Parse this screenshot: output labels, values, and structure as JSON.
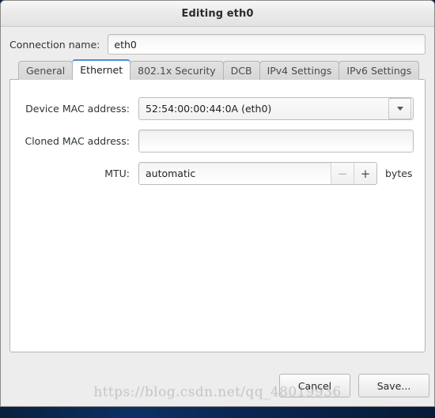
{
  "window": {
    "title": "Editing eth0"
  },
  "connection": {
    "label": "Connection name:",
    "value": "eth0",
    "placeholder": ""
  },
  "tabs": [
    {
      "label": "General",
      "active": false
    },
    {
      "label": "Ethernet",
      "active": true
    },
    {
      "label": "802.1x Security",
      "active": false
    },
    {
      "label": "DCB",
      "active": false
    },
    {
      "label": "IPv4 Settings",
      "active": false
    },
    {
      "label": "IPv6 Settings",
      "active": false
    }
  ],
  "ethernet_form": {
    "device_mac": {
      "label": "Device MAC address:",
      "value": "52:54:00:00:44:0A (eth0)",
      "icon": "chevron-down-icon"
    },
    "cloned_mac": {
      "label": "Cloned MAC address:",
      "value": "",
      "placeholder": ""
    },
    "mtu": {
      "label": "MTU:",
      "value": "automatic",
      "decrement": "−",
      "increment": "+",
      "unit": "bytes"
    }
  },
  "actions": {
    "cancel_label": "Cancel",
    "save_label": "Save..."
  },
  "watermark": {
    "text": "https://blog.csdn.net/qq_48019936"
  },
  "colors": {
    "accent": "#4a90d9",
    "window_bg": "#ededed",
    "panel_bg": "#ffffff",
    "desktop_bg": "#0a2550",
    "border": "#b4b4b2",
    "text": "#2e3436"
  }
}
